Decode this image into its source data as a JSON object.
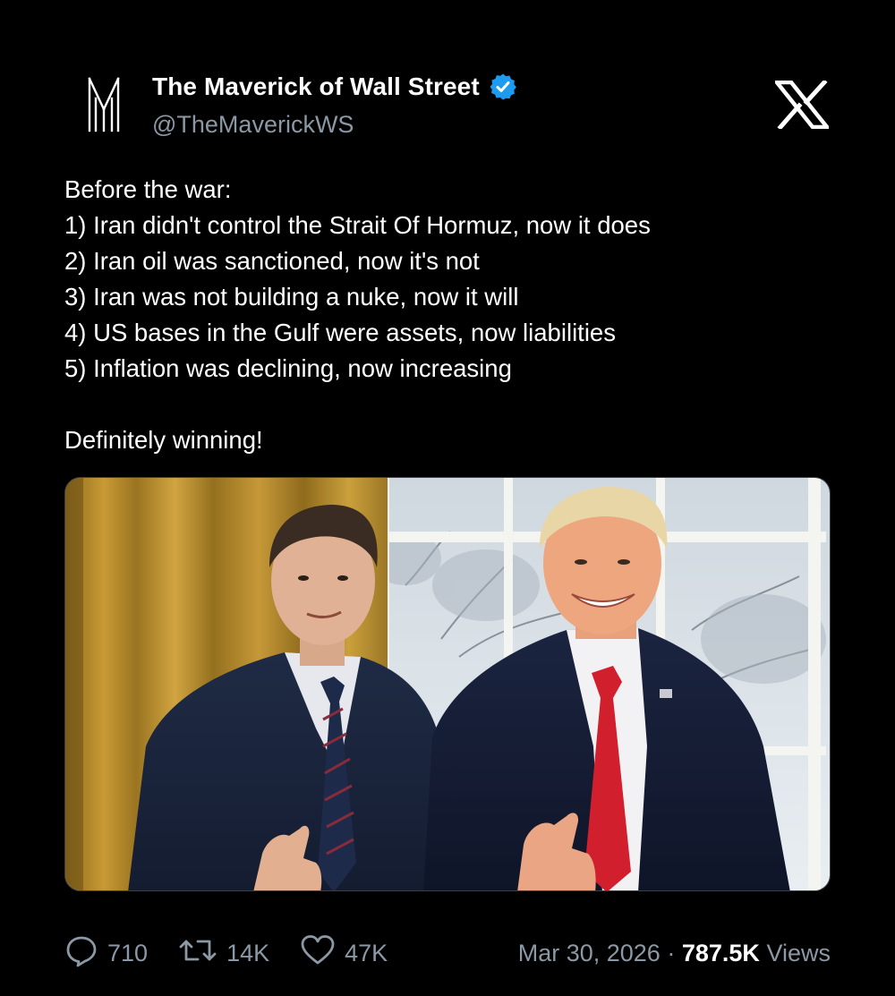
{
  "author": {
    "display_name": "The Maverick of Wall Street",
    "handle": "@TheMaverickWS",
    "avatar_icon": "maverick-m-logo-icon",
    "verified_icon": "verified-badge-icon",
    "verified_color": "#1d9bf0"
  },
  "platform": {
    "logo_icon": "x-logo-icon"
  },
  "tweet": {
    "lines": [
      "Before the war:",
      "1) Iran didn't control the Strait Of Hormuz, now it does",
      "2) Iran oil was sanctioned, now it's not",
      "3) Iran was not building a nuke, now it will",
      "4) US bases in the Gulf were assets, now liabilities",
      "5) Inflation was declining, now increasing"
    ],
    "closing": "Definitely winning!"
  },
  "media": {
    "type": "photo"
  },
  "metrics": {
    "replies": "710",
    "reposts": "14K",
    "likes": "47K",
    "reply_icon": "reply-bubble-icon",
    "repost_icon": "repost-icon",
    "like_icon": "heart-icon"
  },
  "meta": {
    "date": "Mar 30, 2026",
    "separator": "·",
    "views_count": "787.5K",
    "views_label": "Views"
  },
  "colors": {
    "background": "#000000",
    "text": "#ffffff",
    "secondary_text": "#8b98a5"
  }
}
